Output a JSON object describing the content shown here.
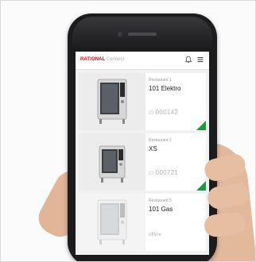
{
  "app": {
    "brand_main": "RATIONAL",
    "brand_sub": "Connect"
  },
  "devices": [
    {
      "location": "Restaurant 1",
      "model": "101 Elektro",
      "serial_tag": "ID",
      "serial": "000142",
      "status_color": "#1a9c3c"
    },
    {
      "location": "Restaurant 2",
      "model": "XS",
      "serial_tag": "ID",
      "serial": "000721",
      "status_color": "#1a9c3c"
    },
    {
      "location": "Restaurant 3",
      "model": "101 Gas",
      "status": "offline"
    }
  ],
  "colors": {
    "accent": "#e2001a",
    "online": "#1a9c3c",
    "phone_body": "#1c1c1e"
  },
  "icons": {
    "header": [
      "bell-icon",
      "menu-icon"
    ]
  }
}
